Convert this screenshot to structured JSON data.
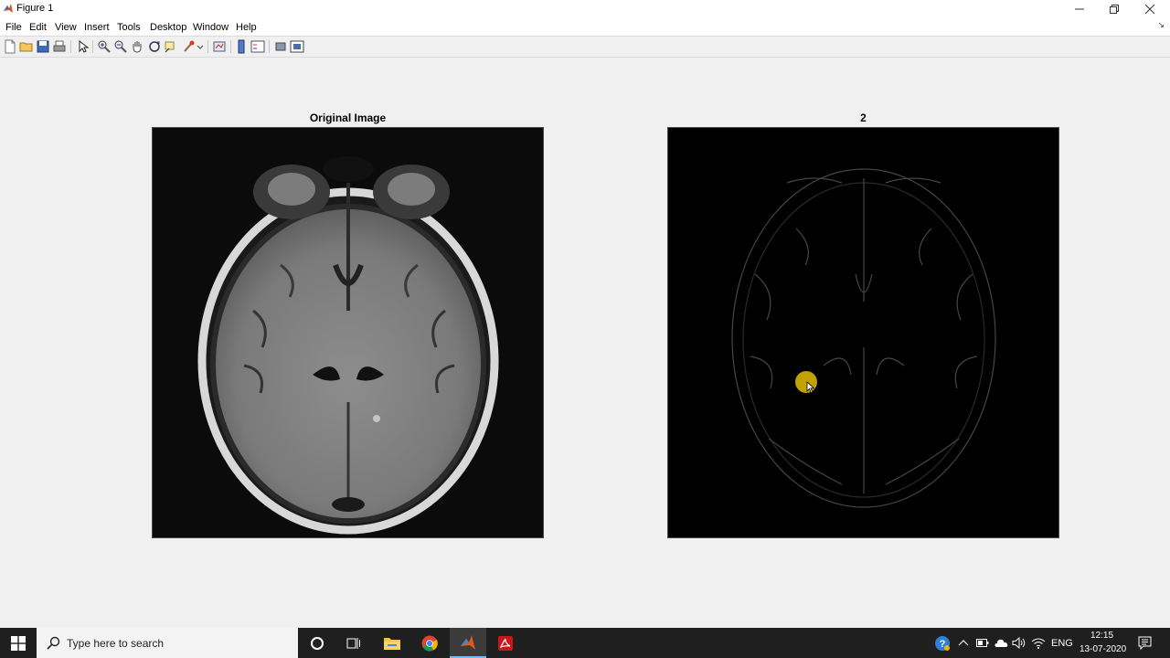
{
  "window": {
    "title": "Figure 1"
  },
  "menu": {
    "items": [
      "File",
      "Edit",
      "View",
      "Insert",
      "Tools",
      "Desktop",
      "Window",
      "Help"
    ]
  },
  "axes": [
    {
      "title": "Original Image"
    },
    {
      "title": "2"
    }
  ],
  "taskbar": {
    "search_placeholder": "Type here to search",
    "language": "ENG",
    "time": "12:15",
    "date": "13-07-2020"
  },
  "colors": {
    "cursor_highlight": "#e8c400",
    "taskbar": "#1f1f1f",
    "chrome_bg": "#f0f0f0"
  }
}
